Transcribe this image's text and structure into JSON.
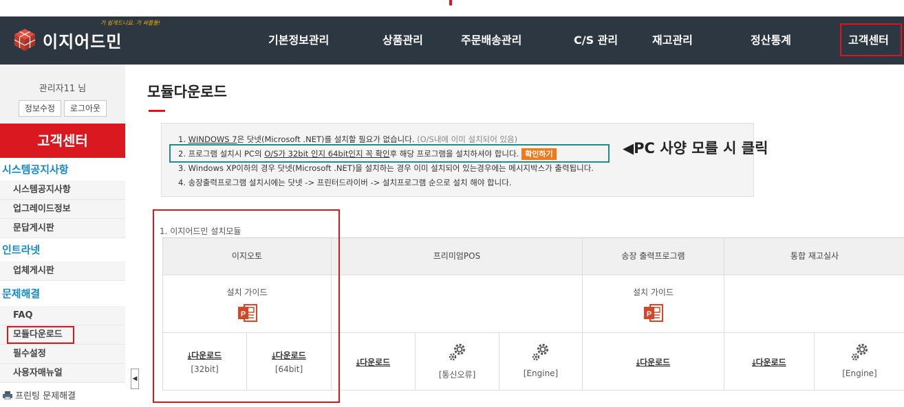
{
  "nav": {
    "logo_text": "이지어드민",
    "logo_slogan": "가 쉽게드니요. 가 싸플들!",
    "menu": [
      {
        "label": "기본정보관리"
      },
      {
        "label": "상품관리"
      },
      {
        "label": "주문배송관리"
      },
      {
        "label": "C/S 관리"
      },
      {
        "label": "재고관리"
      },
      {
        "label": "정산통계"
      },
      {
        "label": "고객센터"
      }
    ]
  },
  "sidebar": {
    "admin_name": "관리자11 님",
    "edit_info": "정보수정",
    "logout": "로그아웃",
    "header": "고객센터",
    "categories": [
      {
        "label": "시스템공지사항"
      },
      {
        "label": "인트라넷"
      },
      {
        "label": "문제해결"
      }
    ],
    "items": [
      {
        "label": "시스템공지사항"
      },
      {
        "label": "업그레이드정보"
      },
      {
        "label": "문답게시판"
      },
      {
        "label": "업체게시판"
      },
      {
        "label": "FAQ"
      },
      {
        "label": "모듈다운로드"
      },
      {
        "label": "필수설정"
      },
      {
        "label": "사용자매뉴얼"
      }
    ],
    "print_help": "프린팅 문제해결",
    "collapse_glyph": "◀"
  },
  "main": {
    "title": "모듈다운로드",
    "notice": {
      "line1_prefix": "1. ",
      "line1_link": "WINDOWS 7",
      "line1_text": "은 닷넷(Microsoft .NET)를 설치할 필요가 없습니다.",
      "line1_gray": " (O/S내에 이미 설치되어 있음)",
      "line2_a": "2. 프로그램 설치시 PC의 ",
      "line2_link": "O/S가 32bit 인지 64bit인지 꼭 확인",
      "line2_b": "후 해당 프로그램을 설치하셔야 합니다.",
      "confirm_button": "확인하기",
      "line3": "3. Windows XP이하의 경우 닷넷(Microsoft .NET)을 설치하는 경우 이미 설치되어 있는경우에는 메시지박스가 출력됩니다.",
      "line4": "4. 송장출력프로그램 설치시에는 닷넷 -> 프린터드라이버 -> 설치프로그램 순으로 설치 해야 합니다."
    },
    "callout": "◀PC 사양 모를 시 클릭",
    "section_label": "1. 이지어드민 설치모듈",
    "table": {
      "headers": [
        "이지오토",
        "프리미엄POS",
        "송장 출력프로그램",
        "통합 재고실사"
      ],
      "guide_label": "설치 가이드",
      "download_label": "다운로드",
      "row3": [
        {
          "type": "download",
          "sub": "[32bit]"
        },
        {
          "type": "download",
          "sub": "[64bit]"
        },
        {
          "type": "download",
          "sub": ""
        },
        {
          "type": "gear",
          "sub": "[통신오류]"
        },
        {
          "type": "gear",
          "sub": "[Engine]"
        },
        {
          "type": "download",
          "sub": ""
        },
        {
          "type": "download",
          "sub": ""
        },
        {
          "type": "gear",
          "sub": "[Engine]"
        }
      ]
    }
  },
  "colors": {
    "nav_bg": "#2d3742",
    "accent_red": "#e0131a",
    "sidebar_header": "#d9191f",
    "category_blue": "#1589c8",
    "confirm_orange": "#f07a1a",
    "highlight_teal": "#1e8a8a"
  },
  "icons": [
    "logo-cube-icon",
    "powerpoint-icon",
    "download-icon",
    "gear-icon",
    "printer-icon",
    "collapse-arrow-icon"
  ]
}
